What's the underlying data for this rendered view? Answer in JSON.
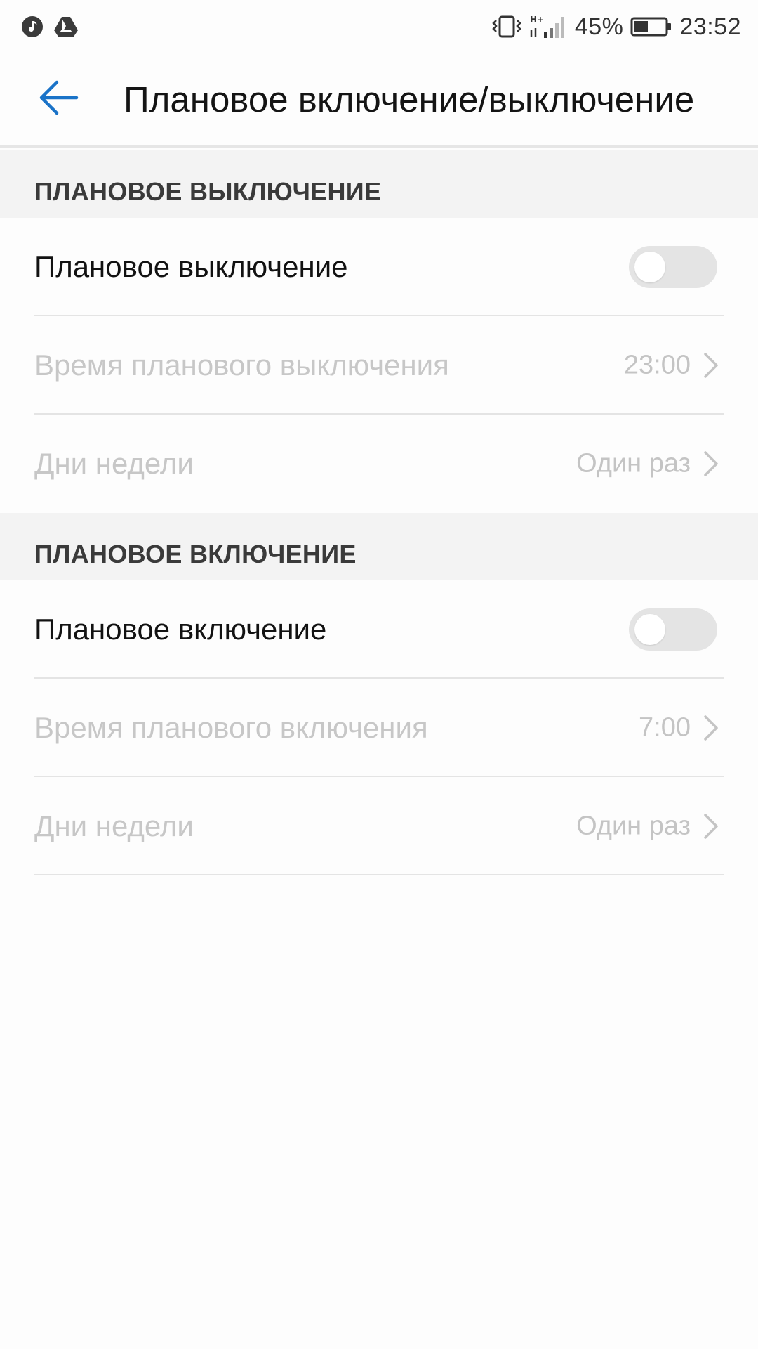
{
  "status_bar": {
    "left_icons": [
      "music-note-icon",
      "drive-icon"
    ],
    "right_icons": [
      "vibrate-icon",
      "hplus-signal-icon",
      "battery-icon"
    ],
    "battery_percent": "45%",
    "battery_level": 0.45,
    "time": "23:52"
  },
  "header": {
    "back_icon": "arrow-left-icon",
    "title": "Плановое включение/выключение",
    "accent_color": "#1a73c8"
  },
  "shutdown_section": {
    "title": "ПЛАНОВОЕ ВЫКЛЮЧЕНИЕ",
    "toggle_label": "Плановое выключение",
    "toggle_on": false,
    "time_label": "Время планового выключения",
    "time_value": "23:00",
    "days_label": "Дни недели",
    "days_value": "Один раз"
  },
  "startup_section": {
    "title": "ПЛАНОВОЕ ВКЛЮЧЕНИЕ",
    "toggle_label": "Плановое включение",
    "toggle_on": false,
    "time_label": "Время планового включения",
    "time_value": "7:00",
    "days_label": "Дни недели",
    "days_value": "Один раз"
  }
}
